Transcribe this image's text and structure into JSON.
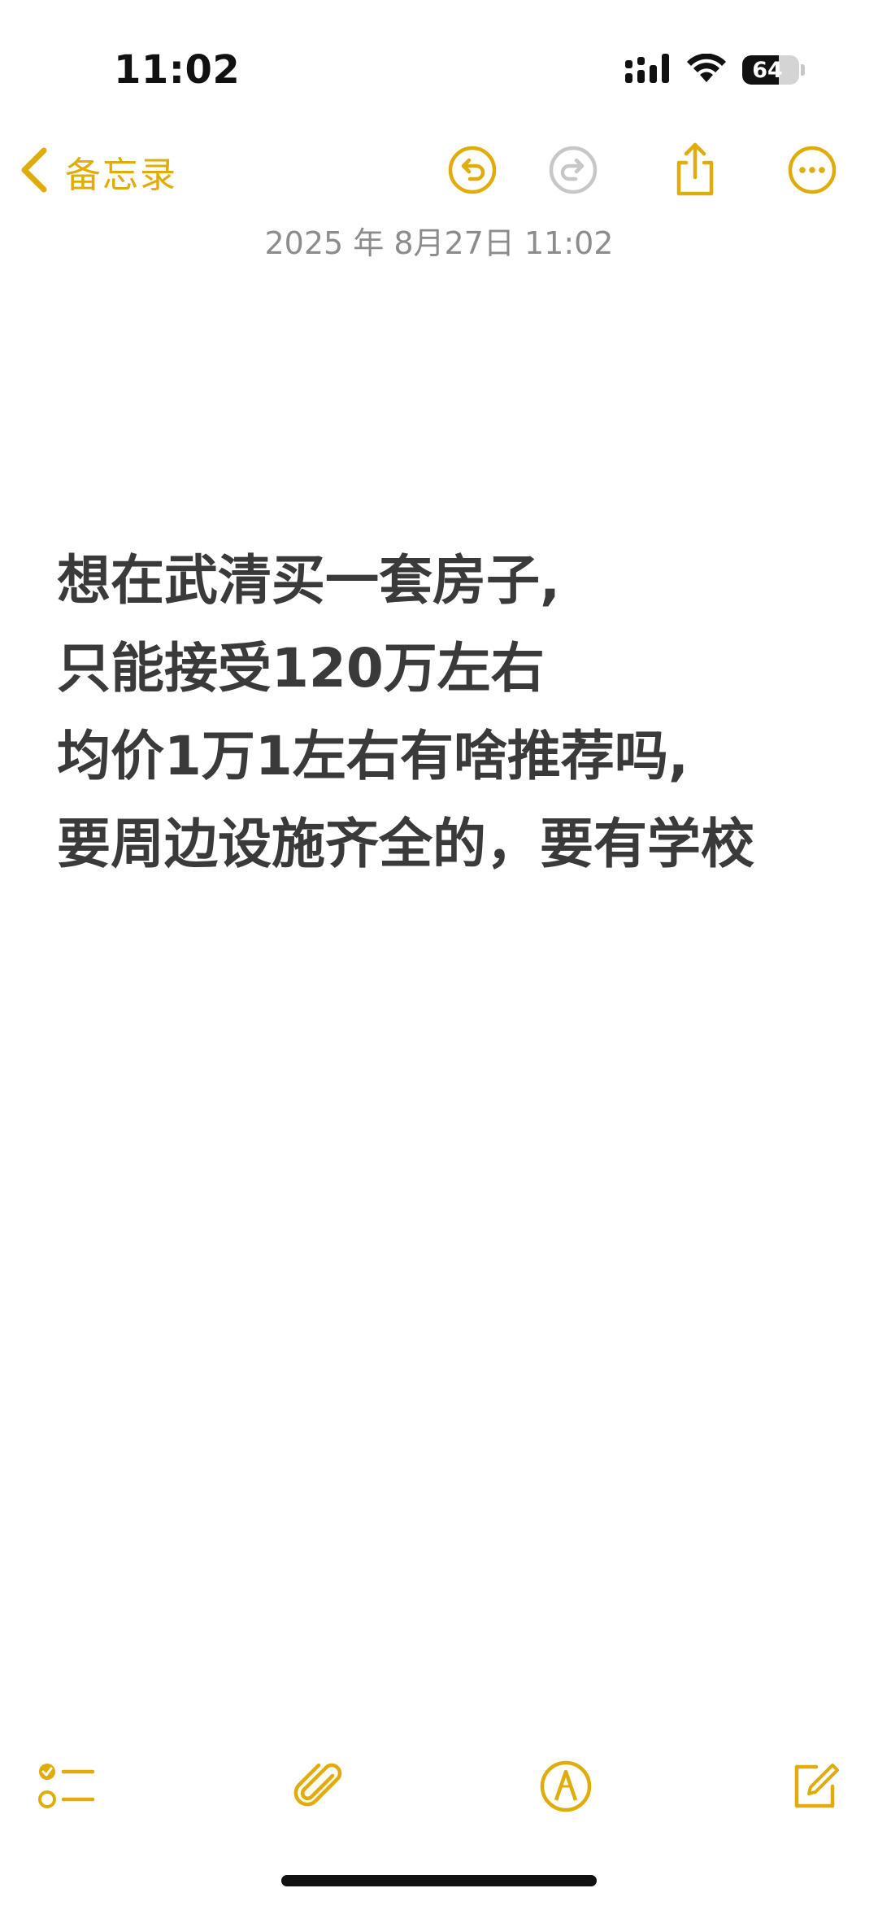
{
  "status_bar": {
    "time": "11:02",
    "battery_percent": "64",
    "battery_level": 0.64
  },
  "nav": {
    "back_label": "备忘录",
    "icons": [
      "chevron-left-icon",
      "undo-icon",
      "redo-icon",
      "share-icon",
      "more-icon"
    ]
  },
  "note": {
    "date": "2025 年 8月27日 11:02",
    "lines": [
      "想在武清买一套房子,",
      "只能接受120万左右",
      "均价1万1左右有啥推荐吗,",
      "要周边设施齐全的，要有学校"
    ]
  },
  "toolbar": {
    "icons": [
      "checklist-icon",
      "paperclip-icon",
      "markup-pen-icon",
      "compose-icon"
    ]
  },
  "colors": {
    "accent": "#e0ac0a",
    "disabled": "#c7c7c7",
    "text": "#3a3a3a",
    "date_text": "#8c8c8c"
  }
}
